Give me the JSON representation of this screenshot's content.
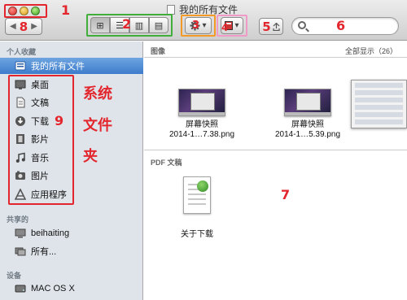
{
  "window": {
    "title": "我的所有文件"
  },
  "annotations": {
    "n1": "1",
    "n2": "2",
    "n3": "3",
    "n4": "4",
    "n5": "5",
    "n6": "6",
    "n7": "7",
    "n8": "8",
    "n9": "9",
    "system_folders_label": [
      "系统",
      "文件",
      "夹"
    ],
    "color": "#e3262d"
  },
  "toolbar": {
    "back_icon": "◀",
    "forward_icon": "▶",
    "view_icons": [
      "⊞",
      "☰",
      "▥",
      "▤"
    ],
    "action_icon": "gear-icon",
    "arrange_icon": "arrange-icon",
    "search_placeholder": ""
  },
  "sidebar": {
    "favorites_header": "个人收藏",
    "favorites": [
      {
        "label": "我的所有文件",
        "icon": "all-files-icon",
        "selected": true
      },
      {
        "label": "桌面",
        "icon": "desktop-icon"
      },
      {
        "label": "文稿",
        "icon": "documents-icon"
      },
      {
        "label": "下载",
        "icon": "downloads-icon"
      },
      {
        "label": "影片",
        "icon": "movies-icon"
      },
      {
        "label": "音乐",
        "icon": "music-icon"
      },
      {
        "label": "图片",
        "icon": "pictures-icon"
      },
      {
        "label": "应用程序",
        "icon": "applications-icon"
      }
    ],
    "shared_header": "共享的",
    "shared": [
      {
        "label": "beihaiting",
        "icon": "computer-icon"
      },
      {
        "label": "所有...",
        "icon": "network-icon"
      }
    ],
    "devices_header": "设备",
    "devices": [
      {
        "label": "MAC OS X",
        "icon": "disk-icon"
      }
    ]
  },
  "main": {
    "images_header": "图像",
    "show_all": "全部显示（26）",
    "images": [
      {
        "name_line1": "屏幕快照",
        "name_line2": "2014-1…7.38.png"
      },
      {
        "name_line1": "屏幕快照",
        "name_line2": "2014-1…5.39.png"
      }
    ],
    "pdf_header": "PDF 文稿",
    "pdfs": [
      {
        "name": "关于下载"
      }
    ]
  }
}
